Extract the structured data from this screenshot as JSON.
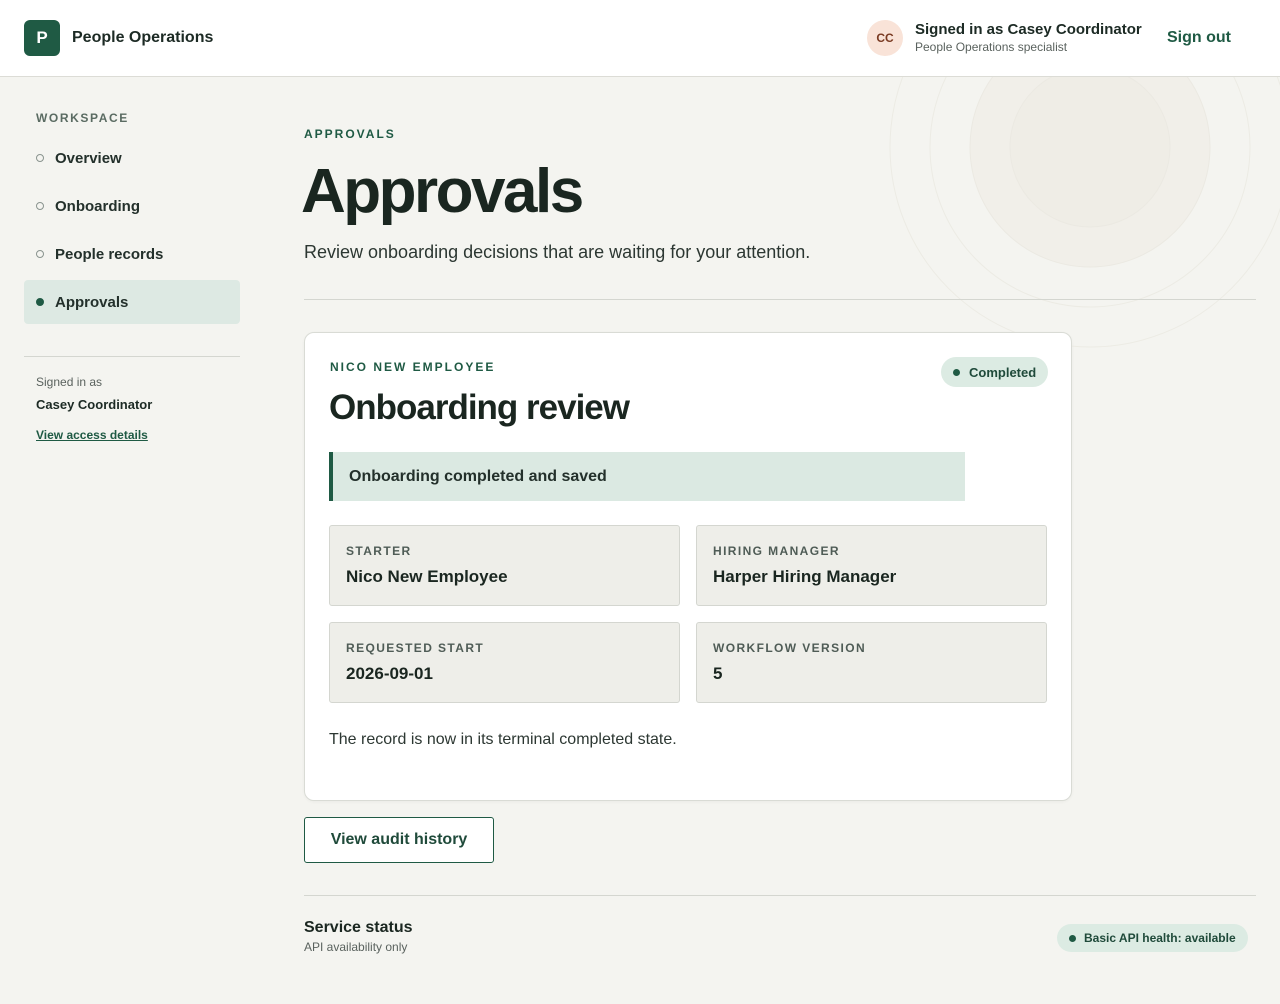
{
  "header": {
    "logo_letter": "P",
    "app_name": "People Operations",
    "avatar_initials": "CC",
    "signed_in_text": "Signed in as Casey Coordinator",
    "user_role": "People Operations specialist",
    "sign_out_label": "Sign out"
  },
  "sidebar": {
    "section_label": "WORKSPACE",
    "items": [
      {
        "label": "Overview",
        "active": false
      },
      {
        "label": "Onboarding",
        "active": false
      },
      {
        "label": "People records",
        "active": false
      },
      {
        "label": "Approvals",
        "active": true
      }
    ],
    "signed_in_label": "Signed in as",
    "user_name": "Casey Coordinator",
    "access_link": "View access details"
  },
  "main": {
    "eyebrow": "APPROVALS",
    "title": "Approvals",
    "subtitle": "Review onboarding decisions that are waiting for your attention."
  },
  "card": {
    "eyebrow": "NICO NEW EMPLOYEE",
    "title": "Onboarding review",
    "status_badge": "Completed",
    "notice": "Onboarding completed and saved",
    "fields": [
      {
        "label": "STARTER",
        "value": "Nico New Employee"
      },
      {
        "label": "HIRING MANAGER",
        "value": "Harper Hiring Manager"
      },
      {
        "label": "REQUESTED START",
        "value": "2026-09-01"
      },
      {
        "label": "WORKFLOW VERSION",
        "value": "5"
      }
    ],
    "footer_text": "The record is now in its terminal completed state."
  },
  "actions": {
    "audit_button": "View audit history"
  },
  "service": {
    "title": "Service status",
    "subtitle": "API availability only",
    "health_badge": "Basic API health: available"
  },
  "colors": {
    "brand": "#1f5a44",
    "background": "#f4f4f0",
    "active_nav": "#dde9e3",
    "badge_bg": "#dcebe3"
  }
}
